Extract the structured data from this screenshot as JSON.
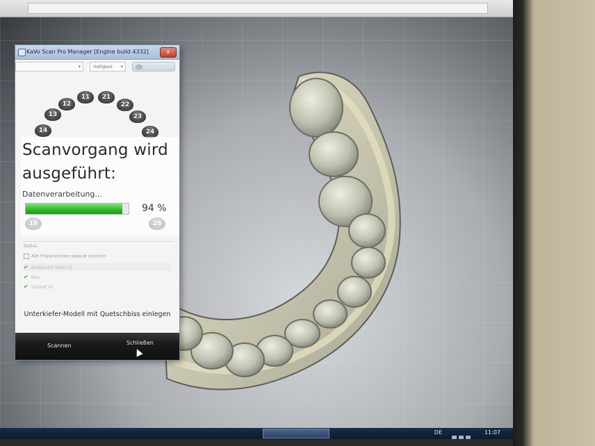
{
  "window": {
    "title": "KaVo Scan Pro Manager [Engine build 4332]",
    "close_label": "x"
  },
  "toolbar": {
    "dropdown1": "",
    "dropdown2": "Helligkeit",
    "toggle_label": ""
  },
  "teeth": [
    "11",
    "21",
    "12",
    "22",
    "13",
    "23",
    "14",
    "24",
    "18",
    "28"
  ],
  "scan": {
    "heading_line1": "Scanvorgang wird",
    "heading_line2": "ausgeführt:",
    "subtext": "Datenverarbeitung...",
    "progress_percent": 94,
    "progress_label": "94 %"
  },
  "status": {
    "label": "Status",
    "checkbox_label": "Alle Präparationen separat scannen",
    "items": [
      "Antagonist Oben 21",
      "Biss",
      "Stumpf 16"
    ]
  },
  "hint": "Unterkiefer-Modell mit Quetschbiss einlegen",
  "footer": {
    "scan_button": "Scannen",
    "close_button": "Schließen"
  },
  "taskbar": {
    "task": "",
    "lang": "DE",
    "clock": "11:07"
  },
  "colors": {
    "progress": "#2fb52a",
    "check": "#3aa93a"
  }
}
